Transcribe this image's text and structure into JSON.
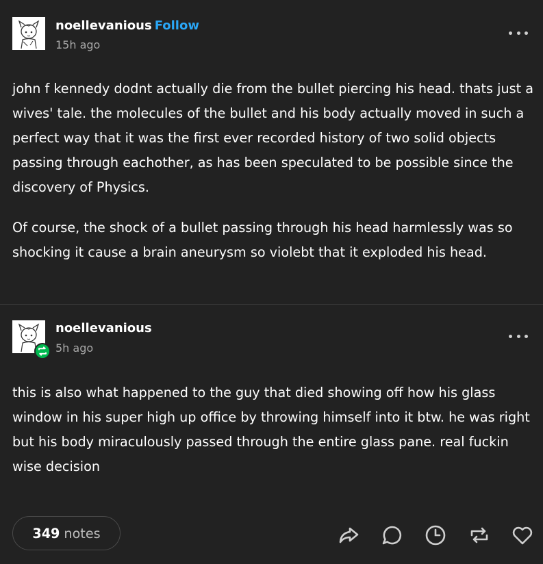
{
  "post": {
    "author": "noellevanious",
    "follow_label": "Follow",
    "timestamp": "15h ago",
    "paragraphs": [
      "john f kennedy dodnt actually die from the bullet piercing his head. thats just a wives' tale. the molecules of the bullet and his body actually moved in such a perfect way that it was the first ever recorded history of two solid objects passing through eachother, as has been speculated to be possible since the discovery of Physics.",
      "Of course, the shock of a bullet passing through his head harmlessly was so shocking it cause a brain aneurysm so violebt that it exploded his head."
    ]
  },
  "reblog": {
    "author": "noellevanious",
    "timestamp": "5h ago",
    "paragraphs": [
      "this is also what happened to the guy that died showing off how his glass window in his super high up office by throwing himself into it btw. he was right but his body miraculously passed through the entire glass pane. real fuckin wise decision"
    ]
  },
  "footer": {
    "notes_count": "349",
    "notes_word": "notes",
    "actions": [
      "share-icon",
      "reply-icon",
      "clock-icon",
      "reblog-icon",
      "heart-icon"
    ]
  },
  "colors": {
    "background": "#222222",
    "follow": "#2aa7f7",
    "reblog_badge": "#00b84f",
    "secondary_text": "#a8a8a8"
  }
}
